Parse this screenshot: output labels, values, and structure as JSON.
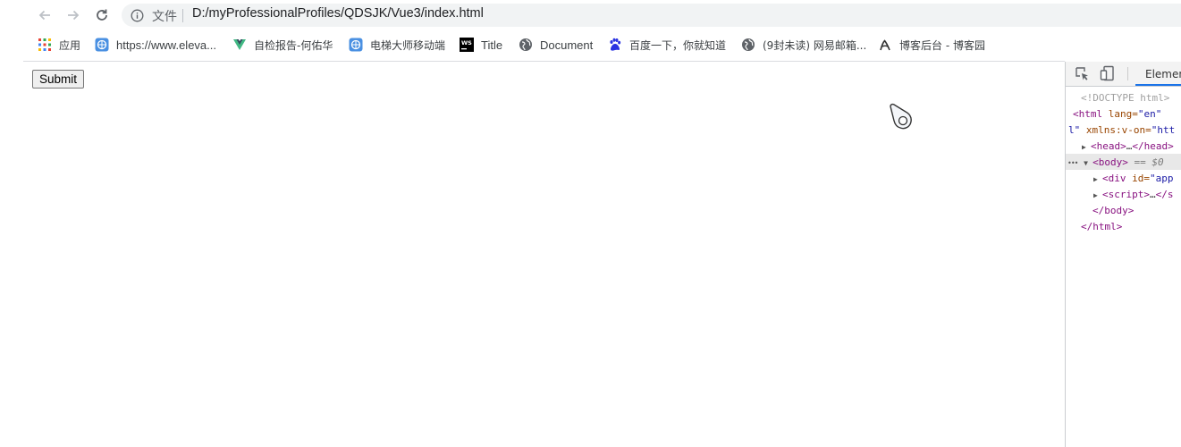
{
  "toolbar": {
    "back_icon": "arrow-back-icon",
    "forward_icon": "arrow-forward-icon",
    "reload_icon": "reload-icon",
    "info_icon": "info-icon",
    "scheme_label": "文件",
    "url": "D:/myProfessionalProfiles/QDSJK/Vue3/index.html"
  },
  "bookmarks": [
    {
      "label": "应用",
      "icon": "apps-grid-icon"
    },
    {
      "label": "https://www.eleva...",
      "icon": "globe-icon"
    },
    {
      "label": "自检报告-何佑华",
      "icon": "vue-logo-icon"
    },
    {
      "label": "电梯大师移动端",
      "icon": "globe-icon"
    },
    {
      "label": "Title",
      "icon": "webstorm-icon"
    },
    {
      "label": "Document",
      "icon": "world-icon"
    },
    {
      "label": "百度一下，你就知道",
      "icon": "baidu-paw-icon"
    },
    {
      "label": "(9封未读) 网易邮箱...",
      "icon": "world-icon"
    },
    {
      "label": "博客后台 - 博客园",
      "icon": "cnblogs-icon"
    }
  ],
  "page": {
    "submit_label": "Submit"
  },
  "devtools": {
    "inspect_icon": "inspect-element-icon",
    "device_icon": "device-toolbar-icon",
    "tab_label": "Elemen",
    "dom": {
      "doctype": "<!DOCTYPE html>",
      "html_open": "<html",
      "html_attr": "lang=",
      "html_val": "\"en\"",
      "html_wrap_val": "l\"",
      "html_wrap_attr": "xmlns:v-on=",
      "html_wrap_val2": "\"htt",
      "head_open": "<head>",
      "ellipsis": "…",
      "head_close": "</head>",
      "dots": "•••",
      "body_open": "<body>",
      "eq0": "== $0",
      "div_open": "<div",
      "div_attr": "id=",
      "div_val": "\"app",
      "script_open": "<script>",
      "script_close": "</s",
      "body_close": "</body>",
      "html_close": "</html>"
    }
  },
  "colors": {
    "tag": "#881280",
    "attr": "#994500",
    "value": "#1a1aa6",
    "active_tab": "#1a73e8"
  }
}
